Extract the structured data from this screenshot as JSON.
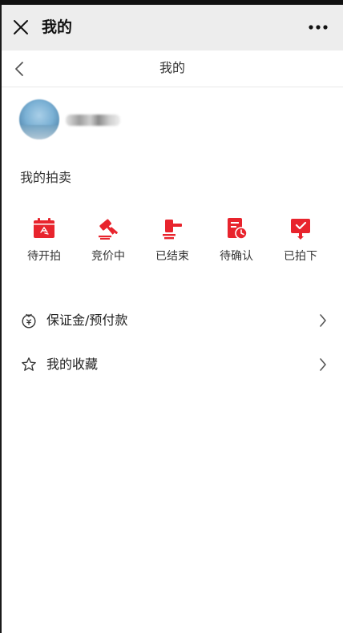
{
  "window": {
    "title": "我的"
  },
  "nav": {
    "title": "我的"
  },
  "profile": {
    "username": ""
  },
  "auction": {
    "section_title": "我的拍卖",
    "items": [
      {
        "label": "待开拍",
        "icon": "calendar-icon"
      },
      {
        "label": "竞价中",
        "icon": "gavel-icon"
      },
      {
        "label": "已结束",
        "icon": "gavel-down-icon"
      },
      {
        "label": "待确认",
        "icon": "document-clock-icon"
      },
      {
        "label": "已拍下",
        "icon": "checked-card-icon"
      }
    ]
  },
  "menu": {
    "items": [
      {
        "label": "保证金/预付款",
        "icon": "deposit-icon"
      },
      {
        "label": "我的收藏",
        "icon": "star-icon"
      }
    ]
  },
  "colors": {
    "accent": "#e8242d",
    "wechat_bar": "#ededed",
    "text": "#222222"
  }
}
